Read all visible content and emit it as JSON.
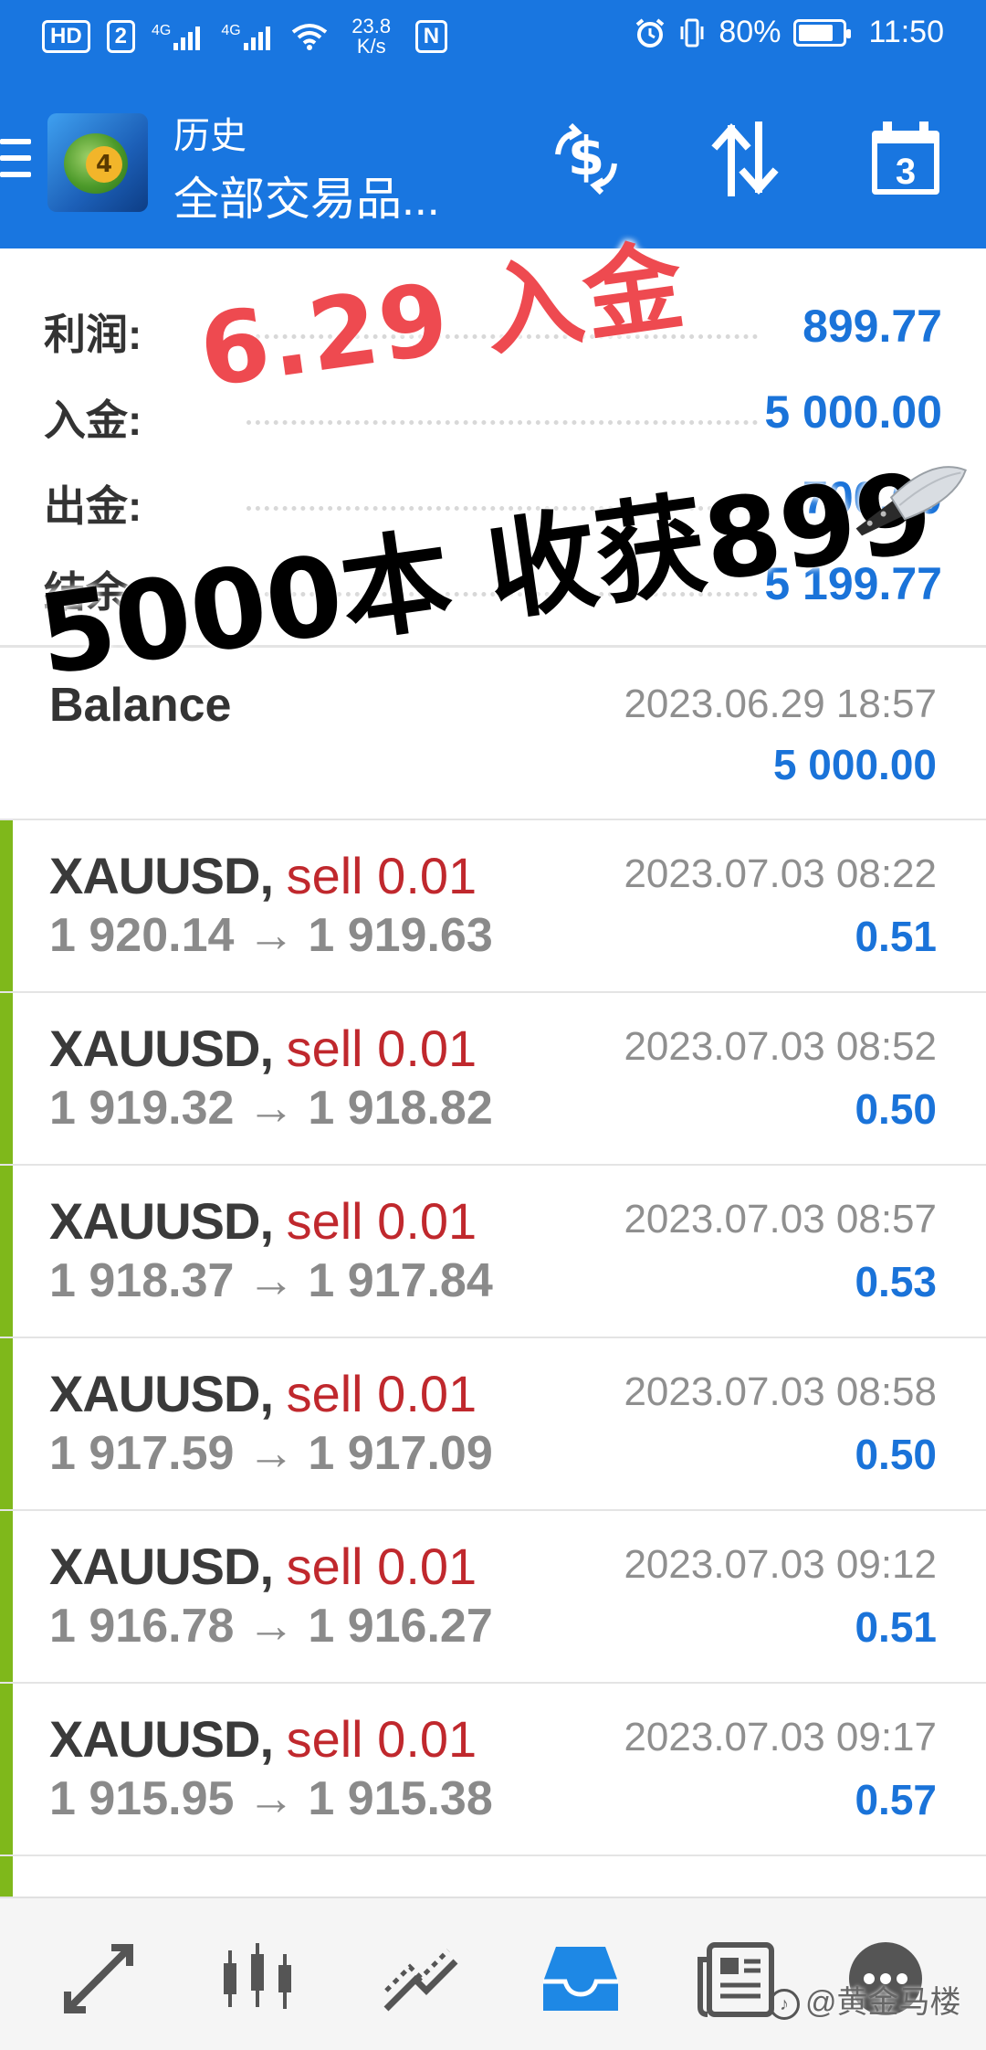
{
  "status_bar": {
    "hd": "HD",
    "sim": "2",
    "net1": "4G",
    "net2": "4G",
    "speed": "23.8",
    "speed_unit": "K/s",
    "nfc": "N",
    "battery_pct": "80%",
    "battery_level": 0.8,
    "time": "11:50"
  },
  "app_bar": {
    "title": "历史",
    "subtitle": "全部交易品...",
    "calendar_day": "3",
    "logo_digit": "4"
  },
  "summary": [
    {
      "label": "利润:",
      "value": "899.77"
    },
    {
      "label": "入金:",
      "value": "5 000.00"
    },
    {
      "label": "出金:",
      "value": "-700.00"
    },
    {
      "label": "结余:",
      "value": "5 199.77"
    }
  ],
  "balance": {
    "label": "Balance",
    "time": "2023.06.29 18:57",
    "value": "5 000.00"
  },
  "trades": [
    {
      "symbol": "XAUUSD",
      "side": "sell 0.01",
      "open": "1 920.14",
      "close": "1 919.63",
      "time": "2023.07.03 08:22",
      "profit": "0.51"
    },
    {
      "symbol": "XAUUSD",
      "side": "sell 0.01",
      "open": "1 919.32",
      "close": "1 918.82",
      "time": "2023.07.03 08:52",
      "profit": "0.50"
    },
    {
      "symbol": "XAUUSD",
      "side": "sell 0.01",
      "open": "1 918.37",
      "close": "1 917.84",
      "time": "2023.07.03 08:57",
      "profit": "0.53"
    },
    {
      "symbol": "XAUUSD",
      "side": "sell 0.01",
      "open": "1 917.59",
      "close": "1 917.09",
      "time": "2023.07.03 08:58",
      "profit": "0.50"
    },
    {
      "symbol": "XAUUSD",
      "side": "sell 0.01",
      "open": "1 916.78",
      "close": "1 916.27",
      "time": "2023.07.03 09:12",
      "profit": "0.51"
    },
    {
      "symbol": "XAUUSD",
      "side": "sell 0.01",
      "open": "1 915.95",
      "close": "1 915.38",
      "time": "2023.07.03 09:17",
      "profit": "0.57"
    }
  ],
  "arrow": "→",
  "comma": ",",
  "annotations": {
    "red_text": "6.29 入金",
    "black_text": "5000本 收获899"
  },
  "watermark": {
    "text": "@黄金马楼"
  },
  "colors": {
    "app_bar": "#1976e0",
    "value_blue": "#1a73d9",
    "sell_red": "#c0282d",
    "trade_bar_green": "#7fb81b",
    "annotation_red": "#ee4a50"
  },
  "bottom_nav": [
    {
      "icon": "quotes-icon",
      "active": false
    },
    {
      "icon": "chart-icon",
      "active": false
    },
    {
      "icon": "trade-icon",
      "active": false
    },
    {
      "icon": "history-icon",
      "active": true
    },
    {
      "icon": "news-icon",
      "active": false
    },
    {
      "icon": "messages-icon",
      "active": false
    }
  ]
}
